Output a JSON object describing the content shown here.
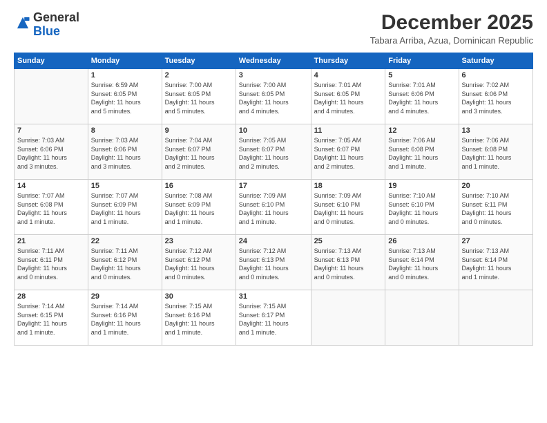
{
  "header": {
    "logo": {
      "general": "General",
      "blue": "Blue"
    },
    "title": "December 2025",
    "subtitle": "Tabara Arriba, Azua, Dominican Republic"
  },
  "calendar": {
    "columns": [
      "Sunday",
      "Monday",
      "Tuesday",
      "Wednesday",
      "Thursday",
      "Friday",
      "Saturday"
    ],
    "rows": [
      [
        {
          "num": "",
          "info": ""
        },
        {
          "num": "1",
          "info": "Sunrise: 6:59 AM\nSunset: 6:05 PM\nDaylight: 11 hours\nand 5 minutes."
        },
        {
          "num": "2",
          "info": "Sunrise: 7:00 AM\nSunset: 6:05 PM\nDaylight: 11 hours\nand 5 minutes."
        },
        {
          "num": "3",
          "info": "Sunrise: 7:00 AM\nSunset: 6:05 PM\nDaylight: 11 hours\nand 4 minutes."
        },
        {
          "num": "4",
          "info": "Sunrise: 7:01 AM\nSunset: 6:05 PM\nDaylight: 11 hours\nand 4 minutes."
        },
        {
          "num": "5",
          "info": "Sunrise: 7:01 AM\nSunset: 6:06 PM\nDaylight: 11 hours\nand 4 minutes."
        },
        {
          "num": "6",
          "info": "Sunrise: 7:02 AM\nSunset: 6:06 PM\nDaylight: 11 hours\nand 3 minutes."
        }
      ],
      [
        {
          "num": "7",
          "info": "Sunrise: 7:03 AM\nSunset: 6:06 PM\nDaylight: 11 hours\nand 3 minutes."
        },
        {
          "num": "8",
          "info": "Sunrise: 7:03 AM\nSunset: 6:06 PM\nDaylight: 11 hours\nand 3 minutes."
        },
        {
          "num": "9",
          "info": "Sunrise: 7:04 AM\nSunset: 6:07 PM\nDaylight: 11 hours\nand 2 minutes."
        },
        {
          "num": "10",
          "info": "Sunrise: 7:05 AM\nSunset: 6:07 PM\nDaylight: 11 hours\nand 2 minutes."
        },
        {
          "num": "11",
          "info": "Sunrise: 7:05 AM\nSunset: 6:07 PM\nDaylight: 11 hours\nand 2 minutes."
        },
        {
          "num": "12",
          "info": "Sunrise: 7:06 AM\nSunset: 6:08 PM\nDaylight: 11 hours\nand 1 minute."
        },
        {
          "num": "13",
          "info": "Sunrise: 7:06 AM\nSunset: 6:08 PM\nDaylight: 11 hours\nand 1 minute."
        }
      ],
      [
        {
          "num": "14",
          "info": "Sunrise: 7:07 AM\nSunset: 6:08 PM\nDaylight: 11 hours\nand 1 minute."
        },
        {
          "num": "15",
          "info": "Sunrise: 7:07 AM\nSunset: 6:09 PM\nDaylight: 11 hours\nand 1 minute."
        },
        {
          "num": "16",
          "info": "Sunrise: 7:08 AM\nSunset: 6:09 PM\nDaylight: 11 hours\nand 1 minute."
        },
        {
          "num": "17",
          "info": "Sunrise: 7:09 AM\nSunset: 6:10 PM\nDaylight: 11 hours\nand 1 minute."
        },
        {
          "num": "18",
          "info": "Sunrise: 7:09 AM\nSunset: 6:10 PM\nDaylight: 11 hours\nand 0 minutes."
        },
        {
          "num": "19",
          "info": "Sunrise: 7:10 AM\nSunset: 6:10 PM\nDaylight: 11 hours\nand 0 minutes."
        },
        {
          "num": "20",
          "info": "Sunrise: 7:10 AM\nSunset: 6:11 PM\nDaylight: 11 hours\nand 0 minutes."
        }
      ],
      [
        {
          "num": "21",
          "info": "Sunrise: 7:11 AM\nSunset: 6:11 PM\nDaylight: 11 hours\nand 0 minutes."
        },
        {
          "num": "22",
          "info": "Sunrise: 7:11 AM\nSunset: 6:12 PM\nDaylight: 11 hours\nand 0 minutes."
        },
        {
          "num": "23",
          "info": "Sunrise: 7:12 AM\nSunset: 6:12 PM\nDaylight: 11 hours\nand 0 minutes."
        },
        {
          "num": "24",
          "info": "Sunrise: 7:12 AM\nSunset: 6:13 PM\nDaylight: 11 hours\nand 0 minutes."
        },
        {
          "num": "25",
          "info": "Sunrise: 7:13 AM\nSunset: 6:13 PM\nDaylight: 11 hours\nand 0 minutes."
        },
        {
          "num": "26",
          "info": "Sunrise: 7:13 AM\nSunset: 6:14 PM\nDaylight: 11 hours\nand 0 minutes."
        },
        {
          "num": "27",
          "info": "Sunrise: 7:13 AM\nSunset: 6:14 PM\nDaylight: 11 hours\nand 1 minute."
        }
      ],
      [
        {
          "num": "28",
          "info": "Sunrise: 7:14 AM\nSunset: 6:15 PM\nDaylight: 11 hours\nand 1 minute."
        },
        {
          "num": "29",
          "info": "Sunrise: 7:14 AM\nSunset: 6:16 PM\nDaylight: 11 hours\nand 1 minute."
        },
        {
          "num": "30",
          "info": "Sunrise: 7:15 AM\nSunset: 6:16 PM\nDaylight: 11 hours\nand 1 minute."
        },
        {
          "num": "31",
          "info": "Sunrise: 7:15 AM\nSunset: 6:17 PM\nDaylight: 11 hours\nand 1 minute."
        },
        {
          "num": "",
          "info": ""
        },
        {
          "num": "",
          "info": ""
        },
        {
          "num": "",
          "info": ""
        }
      ]
    ]
  }
}
